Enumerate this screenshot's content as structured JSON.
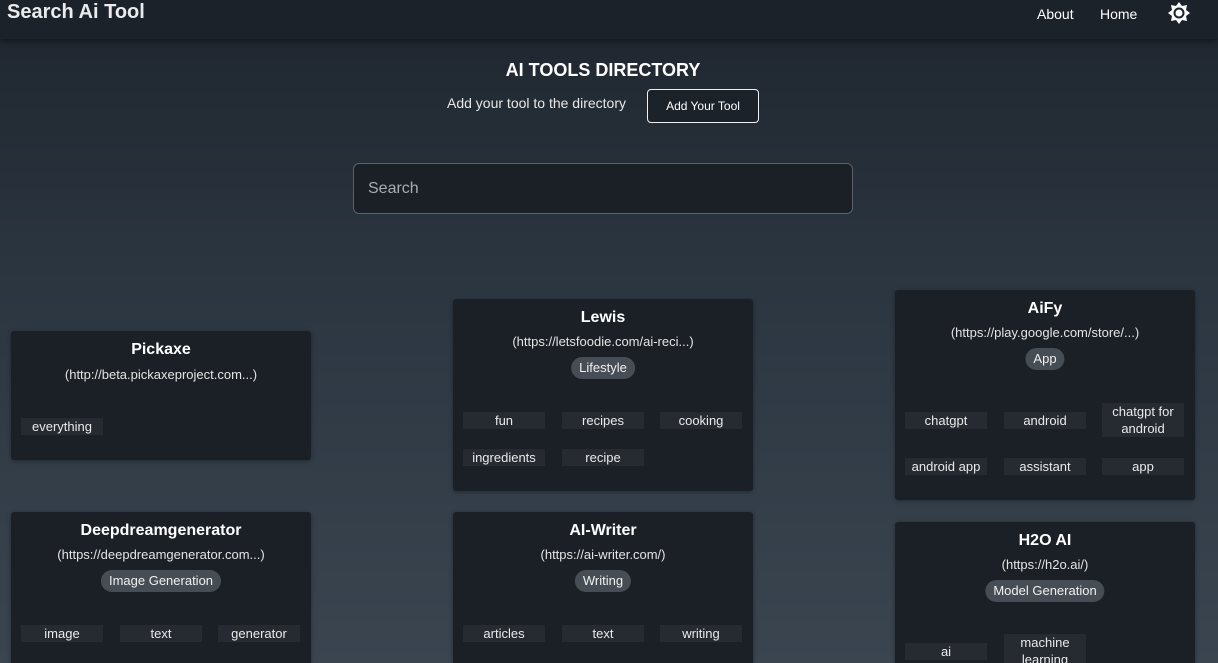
{
  "header": {
    "brand": "Search Ai Tool",
    "nav": {
      "about": "About",
      "home": "Home"
    },
    "theme_icon": "sun-icon"
  },
  "hero": {
    "title": "AI TOOLS DIRECTORY",
    "subtitle": "Add your tool to the directory",
    "add_button": "Add Your Tool"
  },
  "search": {
    "placeholder": "Search",
    "value": ""
  },
  "cards": [
    {
      "title": "Pickaxe",
      "url": "(http://beta.pickaxeproject.com...)",
      "category": "",
      "tags": [
        "everything"
      ]
    },
    {
      "title": "Lewis",
      "url": "(https://letsfoodie.com/ai-reci...)",
      "category": "Lifestyle",
      "tags": [
        "fun",
        "recipes",
        "cooking",
        "ingredients",
        "recipe"
      ]
    },
    {
      "title": "AiFy",
      "url": "(https://play.google.com/store/...)",
      "category": "App",
      "tags": [
        "chatgpt",
        "android",
        "chatgpt for android",
        "android app",
        "assistant",
        "app"
      ]
    },
    {
      "title": "Deepdreamgenerator",
      "url": "(https://deepdreamgenerator.com...)",
      "category": "Image Generation",
      "tags": [
        "image",
        "text",
        "generator"
      ]
    },
    {
      "title": "AI-Writer",
      "url": "(https://ai-writer.com/)",
      "category": "Writing",
      "tags": [
        "articles",
        "text",
        "writing"
      ]
    },
    {
      "title": "H2O AI",
      "url": "(https://h2o.ai/)",
      "category": "Model Generation",
      "tags": [
        "ai",
        "machine learning"
      ]
    }
  ]
}
